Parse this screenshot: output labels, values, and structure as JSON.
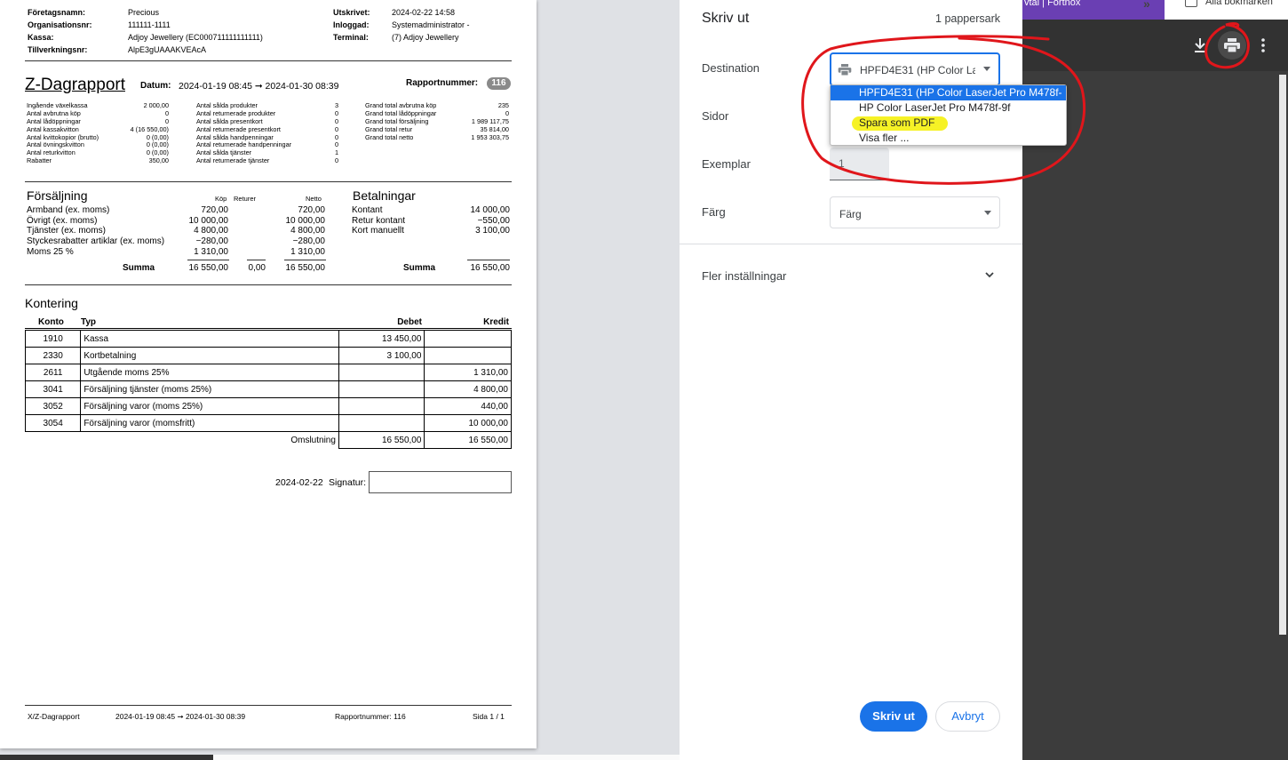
{
  "report": {
    "info_left": [
      {
        "label": "Företagsnamn:",
        "value": "Precious"
      },
      {
        "label": "Organisationsnr:",
        "value": "111111-1111"
      },
      {
        "label": "Kassa:",
        "value": "Adjoy Jewellery (EC000711111111111)"
      },
      {
        "label": "Tillverkningsnr:",
        "value": "AlpE3gUAAAKVEAcA"
      }
    ],
    "info_right": [
      {
        "label": "Utskrivet:",
        "value": "2024-02-22 14:58"
      },
      {
        "label": "Inloggad:",
        "value": "Systemadministrator -"
      },
      {
        "label": "Terminal:",
        "value": "(7) Adjoy Jewellery"
      }
    ],
    "title": "Z-Dagrapport",
    "datum_label": "Datum:",
    "datum_value": "2024-01-19 08:45 ➞ 2024-01-30 08:39",
    "rapportnummer_label": "Rapportnummer:",
    "rapportnummer_value": "116",
    "stats_col1": [
      {
        "label": "Ingående växelkassa",
        "value": "2 000,00"
      },
      {
        "label": "Antal avbrutna köp",
        "value": "0"
      },
      {
        "label": "Antal lådöppningar",
        "value": "0"
      },
      {
        "label": "Antal kassakvitton",
        "value": "4 (16 550,00)"
      },
      {
        "label": "Antal kvittokopior (brutto)",
        "value": "0 (0,00)"
      },
      {
        "label": "Antal övningskvitton",
        "value": "0 (0,00)"
      },
      {
        "label": "Antal returkvitton",
        "value": "0 (0,00)"
      },
      {
        "label": "Rabatter",
        "value": "350,00"
      }
    ],
    "stats_col2": [
      {
        "label": "Antal sålda produkter",
        "value": "3"
      },
      {
        "label": "Antal returnerade produkter",
        "value": "0"
      },
      {
        "label": "Antal sålda presentkort",
        "value": "0"
      },
      {
        "label": "Antal returnerade presentkort",
        "value": "0"
      },
      {
        "label": "Antal sålda handpenningar",
        "value": "0"
      },
      {
        "label": "Antal returnerade handpenningar",
        "value": "0"
      },
      {
        "label": "Antal sålda tjänster",
        "value": "1"
      },
      {
        "label": "Antal returnerade tjänster",
        "value": "0"
      }
    ],
    "stats_col3": [
      {
        "label": "Grand total avbrutna köp",
        "value": "235"
      },
      {
        "label": "Grand total lådöppningar",
        "value": "0"
      },
      {
        "label": "Grand total försäljning",
        "value": "1 989 117,75"
      },
      {
        "label": "Grand total retur",
        "value": "35 814,00"
      },
      {
        "label": "Grand total netto",
        "value": "1 953 303,75"
      }
    ],
    "sales": {
      "title": "Försäljning",
      "headers": [
        "Köp",
        "Returer",
        "Netto"
      ],
      "rows": [
        {
          "label": "Armband (ex. moms)",
          "kop": "720,00",
          "returer": "",
          "netto": "720,00"
        },
        {
          "label": "Övrigt (ex. moms)",
          "kop": "10 000,00",
          "returer": "",
          "netto": "10 000,00"
        },
        {
          "label": "Tjänster (ex. moms)",
          "kop": "4 800,00",
          "returer": "",
          "netto": "4 800,00"
        },
        {
          "label": "Styckesrabatter artiklar (ex. moms)",
          "kop": "−280,00",
          "returer": "",
          "netto": "−280,00"
        },
        {
          "label": "Moms 25 %",
          "kop": "1 310,00",
          "returer": "",
          "netto": "1 310,00"
        }
      ],
      "sum_label": "Summa",
      "sum_kop": "16 550,00",
      "sum_returer": "0,00",
      "sum_netto": "16 550,00"
    },
    "payments": {
      "title": "Betalningar",
      "rows": [
        {
          "label": "Kontant",
          "value": "14 000,00"
        },
        {
          "label": "Retur kontant",
          "value": "−550,00"
        },
        {
          "label": "Kort manuellt",
          "value": "3 100,00"
        }
      ],
      "sum_label": "Summa",
      "sum_value": "16 550,00"
    },
    "kontering": {
      "title": "Kontering",
      "headers": [
        "Konto",
        "Typ",
        "Debet",
        "Kredit"
      ],
      "rows": [
        {
          "konto": "1910",
          "typ": "Kassa",
          "debet": "13 450,00",
          "kredit": ""
        },
        {
          "konto": "2330",
          "typ": "Kortbetalning",
          "debet": "3 100,00",
          "kredit": ""
        },
        {
          "konto": "2611",
          "typ": "Utgående moms 25%",
          "debet": "",
          "kredit": "1 310,00"
        },
        {
          "konto": "3041",
          "typ": "Försäljning tjänster (moms 25%)",
          "debet": "",
          "kredit": "4 800,00"
        },
        {
          "konto": "3052",
          "typ": "Försäljning varor (moms 25%)",
          "debet": "",
          "kredit": "440,00"
        },
        {
          "konto": "3054",
          "typ": "Försäljning varor (momsfritt)",
          "debet": "",
          "kredit": "10 000,00"
        }
      ],
      "omslutning_label": "Omslutning",
      "omslutning_debet": "16 550,00",
      "omslutning_kredit": "16 550,00"
    },
    "signature_date": "2024-02-22",
    "signature_label": "Signatur:",
    "footer": {
      "left": "X/Z-Dagrapport",
      "period": "2024-01-19 08:45 ➞ 2024-01-30 08:39",
      "rapport": "Rapportnummer: 116",
      "page": "Sida 1 / 1"
    }
  },
  "print_dialog": {
    "title": "Skriv ut",
    "sheet_count": "1 pappersark",
    "destination_label": "Destination",
    "destination_value": "HPFD4E31 (HP Color Las",
    "destination_options": [
      "HPFD4E31 (HP Color LaserJet Pro M478f-9f)",
      "HP Color LaserJet Pro M478f-9f",
      "Spara som PDF",
      "Visa fler ..."
    ],
    "pages_label": "Sidor",
    "copies_label": "Exemplar",
    "copies_value": "1",
    "color_label": "Färg",
    "color_value": "Färg",
    "more_settings_label": "Fler inställningar",
    "print_button": "Skriv ut",
    "cancel_button": "Avbryt"
  },
  "browser": {
    "tab_text": "vtal | Fortnox",
    "chevron": "»",
    "bookmarks_label": "Alla bokmärken"
  },
  "colors": {
    "accent": "#1a73e8",
    "annotation_red": "#e0161b",
    "highlight_yellow": "#f5f000"
  },
  "icons": [
    "download-icon",
    "print-icon",
    "more-vert-icon",
    "printer-icon",
    "chevron-down-icon",
    "folder-icon"
  ]
}
